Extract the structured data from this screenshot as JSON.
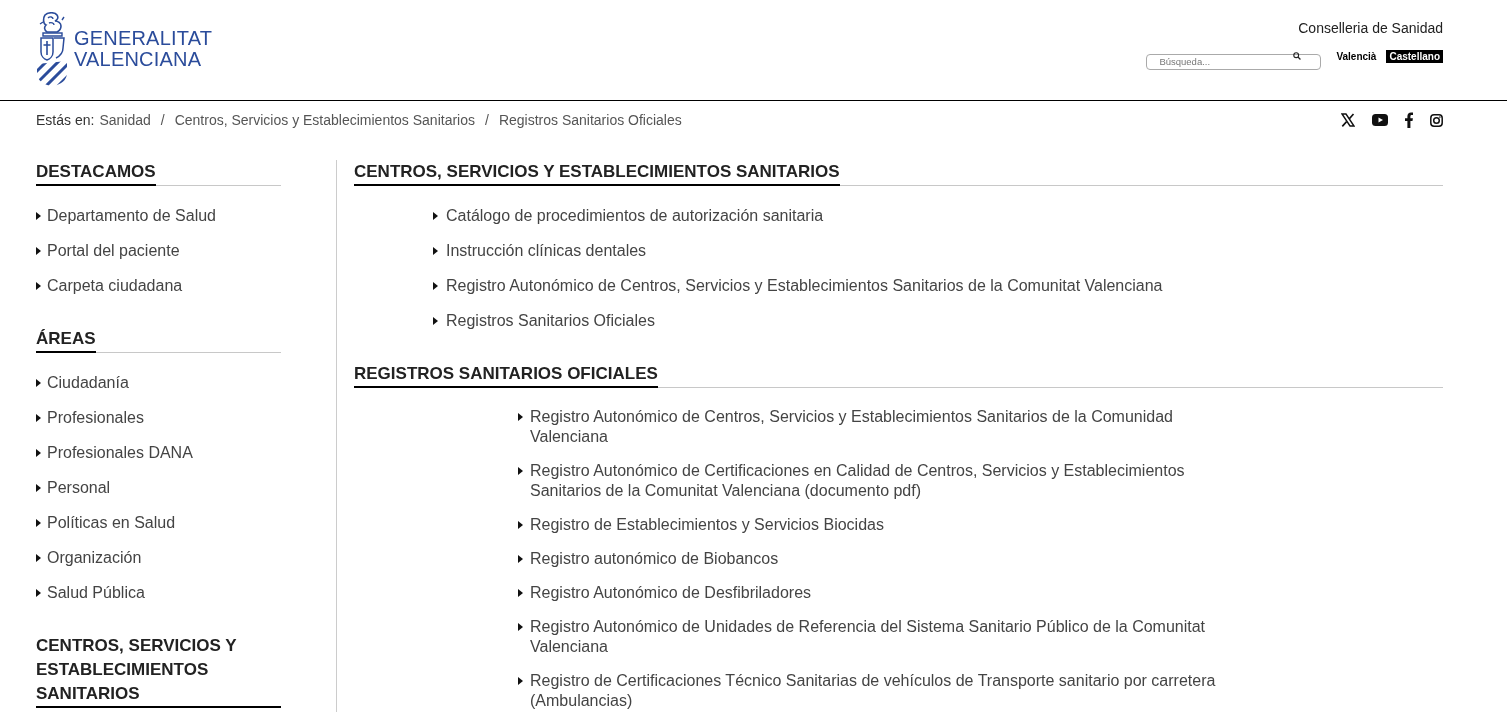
{
  "header": {
    "logo": {
      "lines": [
        "GENERALITAT",
        "VALENCIANA"
      ]
    },
    "department": "Conselleria de Sanidad",
    "search": {
      "placeholder": "Búsqueda..."
    },
    "languages": [
      {
        "label": "Valencià",
        "selected": false
      },
      {
        "label": "Castellano",
        "selected": true
      }
    ]
  },
  "breadcrumb": {
    "label": "Estás en:",
    "items": [
      {
        "label": "Sanidad"
      },
      {
        "label": "Centros, Servicios y Establecimientos Sanitarios"
      },
      {
        "label": "Registros Sanitarios Oficiales"
      }
    ],
    "separators": [
      "/",
      "/"
    ]
  },
  "sidebar": {
    "sections": [
      {
        "title": "DESTACAMOS",
        "items": [
          "Departamento de Salud",
          "Portal del paciente",
          "Carpeta ciudadana"
        ]
      },
      {
        "title": "ÁREAS",
        "items": [
          "Ciudadanía",
          "Profesionales",
          "Profesionales DANA",
          "Personal",
          "Políticas en Salud",
          "Organización",
          "Salud Pública"
        ]
      },
      {
        "title": "CENTROS, SERVICIOS Y ESTABLECIMIENTOS SANITARIOS"
      }
    ]
  },
  "main": {
    "sections": [
      {
        "title": "CENTROS, SERVICIOS Y ESTABLECIMIENTOS SANITARIOS",
        "items": [
          "Catálogo de procedimientos de autorización sanitaria",
          "Instrucción clínicas dentales",
          "Registro Autonómico de Centros, Servicios y Establecimientos Sanitarios de la Comunitat Valenciana",
          "Registros Sanitarios Oficiales"
        ]
      },
      {
        "title": "REGISTROS SANITARIOS OFICIALES",
        "items": [
          "Registro Autonómico de Centros, Servicios y Establecimientos Sanitarios de la Comunidad Valenciana",
          "Registro Autonómico de Certificaciones en Calidad de Centros, Servicios y Establecimientos Sanitarios de la Comunitat Valenciana (documento pdf)",
          "Registro de Establecimientos y Servicios Biocidas",
          "Registro autonómico de Biobancos",
          "Registro Autonómico de Desfibriladores",
          "Registro Autonómico de Unidades de Referencia del Sistema Sanitario Público de la Comunitat Valenciana",
          "Registro de Certificaciones Técnico Sanitarias de vehículos de Transporte sanitario por carretera (Ambulancias)"
        ]
      }
    ]
  }
}
